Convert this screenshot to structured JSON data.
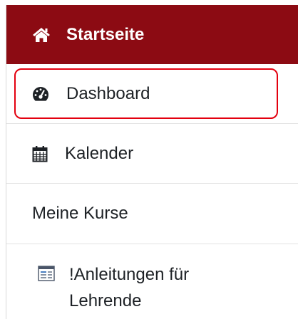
{
  "nav": {
    "items": [
      {
        "label": "Startseite",
        "icon": "home-icon",
        "active": true
      },
      {
        "label": "Dashboard",
        "icon": "dashboard-icon"
      },
      {
        "label": "Kalender",
        "icon": "calendar-icon"
      },
      {
        "label": "Meine Kurse"
      },
      {
        "label": "!Anleitungen für Lehrende",
        "icon": "course-icon"
      }
    ]
  },
  "colors": {
    "active_bg": "#8c0b13",
    "highlight": "#e3000f",
    "text": "#1d2125"
  }
}
